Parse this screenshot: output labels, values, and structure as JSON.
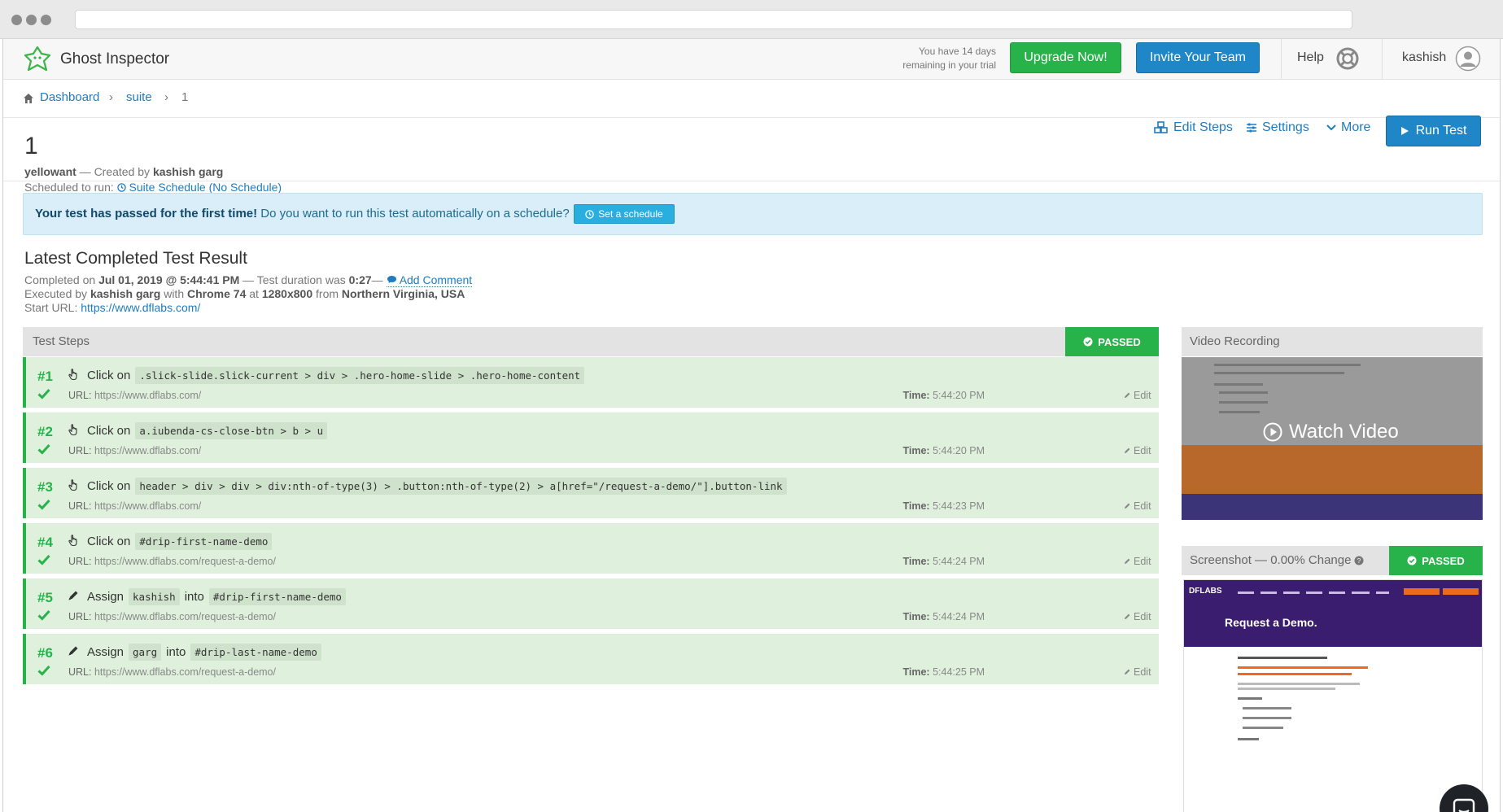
{
  "app": {
    "name": "Ghost Inspector"
  },
  "trial": {
    "text_line1": "You have 14 days",
    "text_line2": "remaining in your trial"
  },
  "nav": {
    "upgrade_label": "Upgrade Now!",
    "invite_label": "Invite Your Team",
    "help_label": "Help",
    "user_name": "kashish"
  },
  "breadcrumb": {
    "dashboard": "Dashboard",
    "suite": "suite",
    "current": "1"
  },
  "test": {
    "title": "1",
    "suite_name": "yellowant",
    "created_by_prefix": " — Created by ",
    "creator": "kashish garg",
    "scheduled_prefix": "Scheduled to run: ",
    "schedule_link": "Suite Schedule (No Schedule)"
  },
  "actions": {
    "edit_steps": "Edit Steps",
    "settings": "Settings",
    "more": "More",
    "run_test": "Run Test"
  },
  "alert": {
    "bold": "Your test has passed for the first time!",
    "text": " Do you want to run this test automatically on a schedule?",
    "button": "Set a schedule"
  },
  "result": {
    "title": "Latest Completed Test Result",
    "completed_prefix": "Completed on ",
    "completed_at": "Jul 01, 2019 @ 5:44:41 PM",
    "duration_prefix": " — Test duration was ",
    "duration": "0:27",
    "duration_suffix": "— ",
    "add_comment": "Add Comment",
    "executed_prefix": "Executed by ",
    "executor": "kashish garg",
    "with": " with ",
    "browser": "Chrome 74",
    "at": " at ",
    "resolution": "1280x800",
    "from": " from ",
    "location": "Northern Virginia, USA",
    "start_url_label": "Start URL: ",
    "start_url": "https://www.dflabs.com/"
  },
  "steps_panel": {
    "title": "Test Steps",
    "status": "PASSED",
    "url_label": "URL:",
    "time_label": "Time:",
    "edit_label": "Edit",
    "steps": [
      {
        "num": "#1",
        "icon": "pointer-icon",
        "action": "Click on",
        "target": ".slick-slide.slick-current > div > .hero-home-slide > .hero-home-content",
        "url": "https://www.dflabs.com/",
        "time": "5:44:20 PM"
      },
      {
        "num": "#2",
        "icon": "pointer-icon",
        "action": "Click on",
        "target": "a.iubenda-cs-close-btn > b > u",
        "url": "https://www.dflabs.com/",
        "time": "5:44:20 PM"
      },
      {
        "num": "#3",
        "icon": "pointer-icon",
        "action": "Click on",
        "target": "header > div > div > div:nth-of-type(3) > .button:nth-of-type(2) > a[href=\"/request-a-demo/\"].button-link",
        "url": "https://www.dflabs.com/",
        "time": "5:44:23 PM"
      },
      {
        "num": "#4",
        "icon": "pointer-icon",
        "action": "Click on",
        "target": "#drip-first-name-demo",
        "url": "https://www.dflabs.com/request-a-demo/",
        "time": "5:44:24 PM"
      },
      {
        "num": "#5",
        "icon": "pencil-icon",
        "action": "Assign",
        "value": "kashish",
        "into": "into",
        "target": "#drip-first-name-demo",
        "url": "https://www.dflabs.com/request-a-demo/",
        "time": "5:44:24 PM"
      },
      {
        "num": "#6",
        "icon": "pencil-icon",
        "action": "Assign",
        "value": "garg",
        "into": "into",
        "target": "#drip-last-name-demo",
        "url": "https://www.dflabs.com/request-a-demo/",
        "time": "5:44:25 PM"
      }
    ]
  },
  "video": {
    "title": "Video Recording",
    "watch_label": "Watch Video"
  },
  "screenshot": {
    "title": "Screenshot — 0.00% Change",
    "status": "PASSED",
    "preview_logo": "DFLABS",
    "preview_heading": "Request a Demo."
  },
  "colors": {
    "accent_blue": "#1f87c8",
    "success_green": "#27b34a",
    "step_bg": "#dff1dd",
    "alert_bg": "#d9eef8"
  }
}
